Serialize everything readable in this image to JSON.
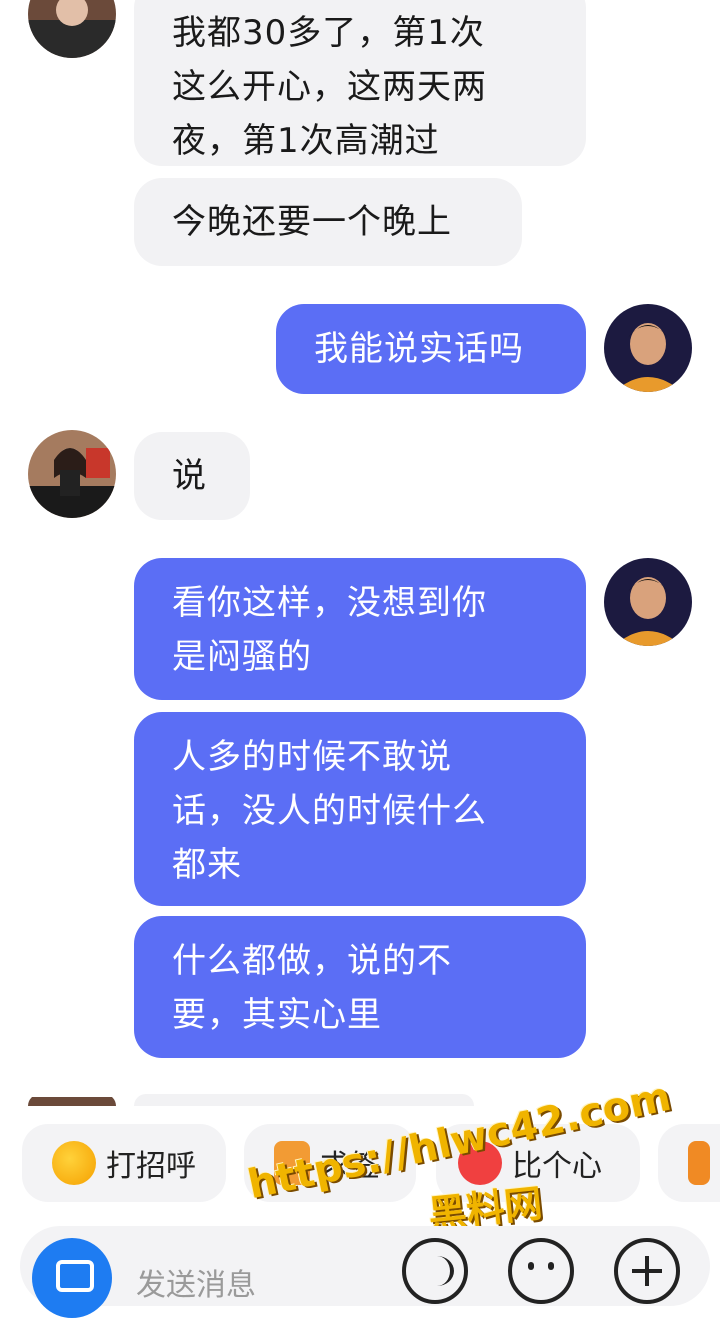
{
  "messages": [
    {
      "side": "recv",
      "text_lines": [
        "我都30多了，第1次",
        "这么开心，这两天两",
        "夜，第1次高潮过"
      ]
    },
    {
      "side": "recv",
      "text": "今晚还要一个晚上"
    },
    {
      "side": "sent",
      "text": "我能说实话吗"
    },
    {
      "side": "recv",
      "text": "说"
    },
    {
      "side": "sent",
      "text_lines": [
        "看你这样，没想到你",
        "是闷骚的"
      ]
    },
    {
      "side": "sent",
      "text_lines": [
        "人多的时候不敢说",
        "话，没人的时候什么",
        "都来"
      ]
    },
    {
      "side": "sent",
      "text_lines": [
        "什么都做，说的不",
        "要，其实心里"
      ]
    }
  ],
  "quick_actions": [
    {
      "label": "打招呼",
      "icon": "smile-emoji-icon"
    },
    {
      "label": "求签",
      "icon": "fortune-stick-icon"
    },
    {
      "label": "比个心",
      "icon": "heart-icon"
    },
    {
      "label": "",
      "icon": "group-icon"
    }
  ],
  "composer": {
    "placeholder": "发送消息"
  },
  "watermark": {
    "line1": "https://hlwc42.com",
    "line2": "黑料网"
  },
  "colors": {
    "sent_bubble": "#5b6ef5",
    "recv_bubble": "#f2f2f4",
    "accent": "#1e7cf2",
    "watermark": "#f0b400"
  }
}
